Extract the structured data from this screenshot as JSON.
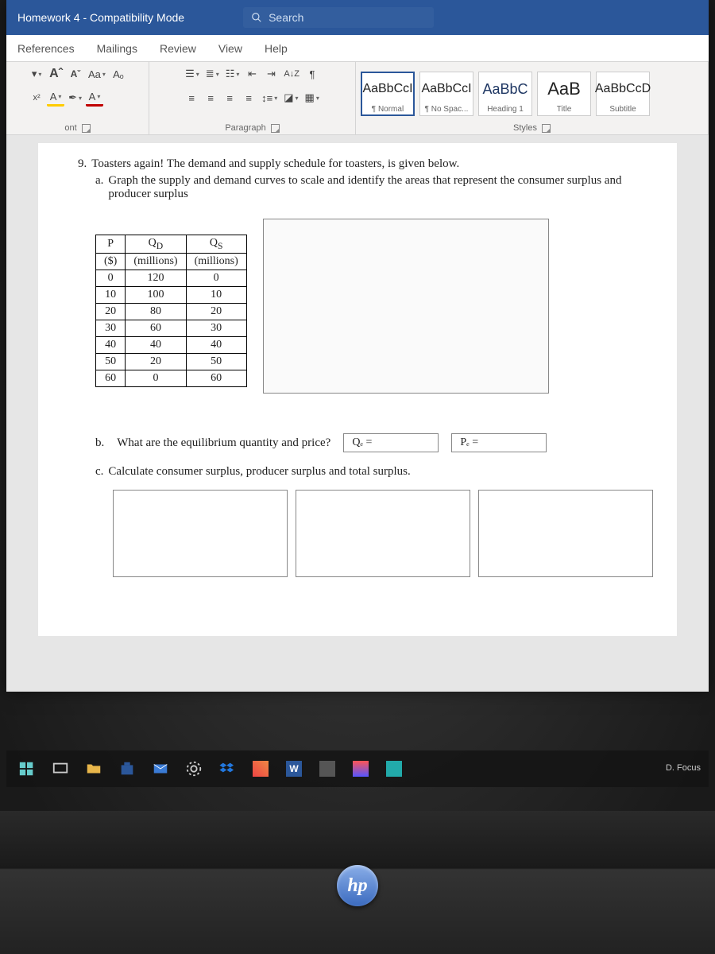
{
  "titlebar": {
    "doc_title": "Homework 4 - Compatibility Mode",
    "search_placeholder": "Search"
  },
  "tabs": [
    "References",
    "Mailings",
    "Review",
    "View",
    "Help"
  ],
  "ribbon": {
    "font": {
      "label": "ont",
      "grow": "Aˆ",
      "shrink": "Aˇ",
      "case": "Aa",
      "clear": "Aₒ",
      "sub": "x²",
      "hl": "A",
      "pen": "✒",
      "fc": "A"
    },
    "paragraph": {
      "label": "Paragraph",
      "bullets": "•—",
      "numbers": "1—",
      "multi": "☰",
      "dec": "⇤",
      "inc": "⇥",
      "sort": "A↓Z",
      "marks": "¶",
      "al_l": "≡",
      "al_c": "≡",
      "al_r": "≡",
      "al_j": "≡",
      "ls": "↕",
      "shade": "▦",
      "border": "⊞"
    },
    "styles": {
      "label": "Styles",
      "items": [
        {
          "preview": "AaBbCcI",
          "label": "¶ Normal",
          "cls": ""
        },
        {
          "preview": "AaBbCcI",
          "label": "¶ No Spac...",
          "cls": ""
        },
        {
          "preview": "AaBbC",
          "label": "Heading 1",
          "cls": "h1"
        },
        {
          "preview": "AaB",
          "label": "Title",
          "cls": "title"
        },
        {
          "preview": "AaBbCcD",
          "label": "Subtitle",
          "cls": ""
        }
      ]
    }
  },
  "document": {
    "q_num": "9.",
    "q_text": "Toasters again!  The demand and supply schedule for toasters, is given below.",
    "a_label": "a.",
    "a_text": "Graph the supply and demand curves to scale and identify the areas that represent the consumer surplus and producer surplus",
    "table": {
      "headers": {
        "p1": "P",
        "p2": "($)",
        "qd1": "Q_D",
        "qd2": "(millions)",
        "qs1": "Q_S",
        "qs2": "(millions)"
      },
      "rows": [
        {
          "p": "0",
          "qd": "120",
          "qs": "0"
        },
        {
          "p": "10",
          "qd": "100",
          "qs": "10"
        },
        {
          "p": "20",
          "qd": "80",
          "qs": "20"
        },
        {
          "p": "30",
          "qd": "60",
          "qs": "30"
        },
        {
          "p": "40",
          "qd": "40",
          "qs": "40"
        },
        {
          "p": "50",
          "qd": "20",
          "qs": "50"
        },
        {
          "p": "60",
          "qd": "0",
          "qs": "60"
        }
      ]
    },
    "b_label": "b.",
    "b_text": "What are the equilibrium quantity and price?",
    "qe": "Qₑ =",
    "pe": "Pₑ =",
    "c_label": "c.",
    "c_text": "Calculate consumer surplus, producer surplus and total surplus."
  },
  "chart_data": {
    "type": "table",
    "title": "Demand and supply schedule for toasters",
    "columns": [
      "P ($)",
      "Q_D (millions)",
      "Q_S (millions)"
    ],
    "rows": [
      [
        0,
        120,
        0
      ],
      [
        10,
        100,
        10
      ],
      [
        20,
        80,
        20
      ],
      [
        30,
        60,
        30
      ],
      [
        40,
        40,
        40
      ],
      [
        50,
        20,
        50
      ],
      [
        60,
        0,
        60
      ]
    ]
  },
  "taskbar": {
    "time": "D. Focus"
  },
  "hp": "hp"
}
